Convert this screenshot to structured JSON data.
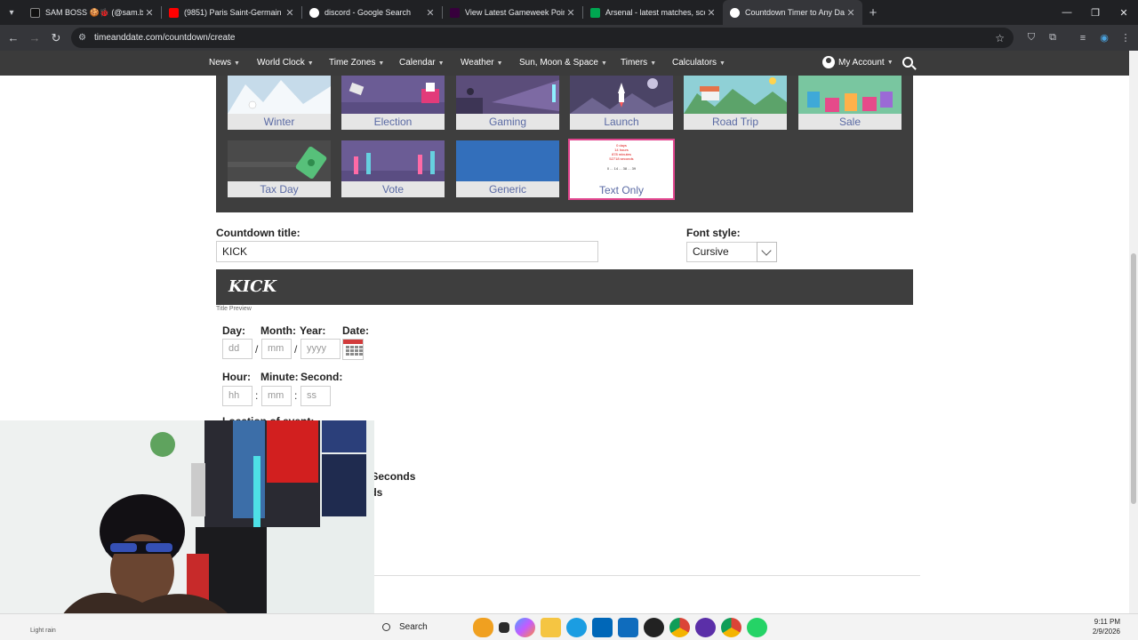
{
  "browser": {
    "tabs": [
      {
        "title": "SAM BOSS 🍪🐞 (@sam.boss...",
        "favicon_color": "#111111",
        "active": false
      },
      {
        "title": "(9851) Paris Saint-Germain (5-0...",
        "favicon_color": "#ff0000",
        "active": false
      },
      {
        "title": "discord - Google Search",
        "favicon_color": "#ffffff",
        "active": false
      },
      {
        "title": "View Latest Gameweek Points |...",
        "favicon_color": "#37003c",
        "active": false
      },
      {
        "title": "Arsenal - latest matches, scores...",
        "favicon_color": "#00a651",
        "active": false
      },
      {
        "title": "Countdown Timer to Any Date",
        "favicon_color": "#ffffff",
        "active": true
      }
    ],
    "url": "timeanddate.com/countdown/create"
  },
  "site_nav": {
    "items": [
      "News",
      "World Clock",
      "Time Zones",
      "Calendar",
      "Weather",
      "Sun, Moon & Space",
      "Timers",
      "Calculators"
    ],
    "account": "My Account"
  },
  "themes": {
    "row1": [
      "Winter",
      "Election",
      "Gaming",
      "Launch",
      "Road Trip",
      "Sale"
    ],
    "row2": [
      "Tax Day",
      "Vote",
      "Generic",
      "Text Only"
    ],
    "selected": "Text Only",
    "text_only_preview": {
      "lines": [
        "0 days",
        "14 hours",
        "878 minutes",
        "52718 seconds"
      ],
      "bottom": "0 ... 14 ... 38 ... 39"
    }
  },
  "form": {
    "title_label": "Countdown title:",
    "title_value": "KICK",
    "font_style_label": "Font style:",
    "font_style_value": "Cursive",
    "preview_text": "KICK",
    "preview_caption": "Title Preview",
    "day_label": "Day:",
    "month_label": "Month:",
    "year_label": "Year:",
    "date_label": "Date:",
    "day_placeholder": "dd",
    "month_placeholder": "mm",
    "year_placeholder": "yyyy",
    "hour_label": "Hour:",
    "minute_label": "Minute:",
    "second_label": "Second:",
    "hour_placeholder": "hh",
    "minute_placeholder": "mm",
    "second_placeholder": "ss",
    "date_sep": "/",
    "time_sep": ":",
    "location_label_partial": "Location of event:",
    "option1_partial": "...tes / Seconds",
    "option2_partial": "...conds"
  },
  "taskbar": {
    "search_label": "Search",
    "time": "9:11 PM",
    "date": "2/9/2026",
    "weather_partial": "Light rain"
  }
}
